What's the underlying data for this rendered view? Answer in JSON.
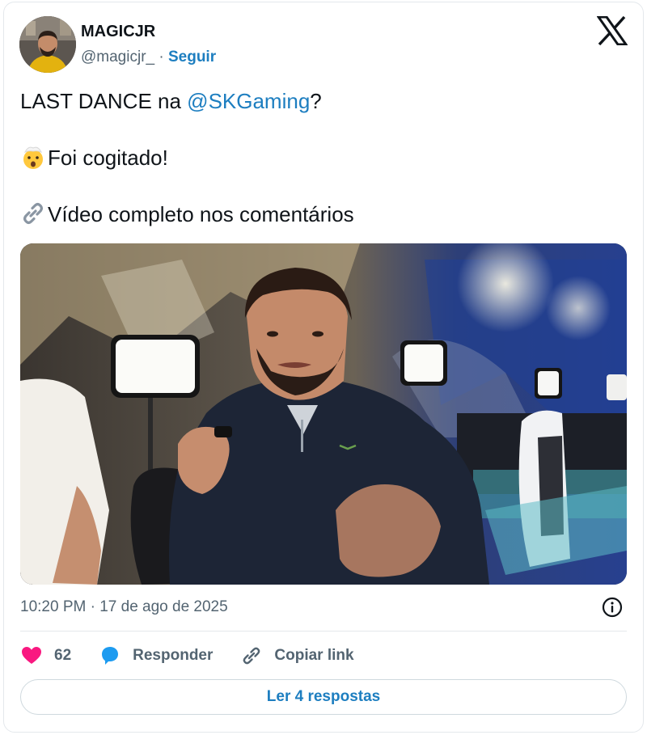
{
  "author": {
    "display_name": "MAGICJR",
    "handle": "@magicjr_",
    "separator": " · ",
    "follow_label": "Seguir"
  },
  "tweet": {
    "line1_prefix": "LAST DANCE na ",
    "line1_mention": "@SKGaming",
    "line1_suffix": "?",
    "line2_text": "Foi cogitado!",
    "line2_emoji": "exploding-head-icon",
    "line3_text": "Vídeo completo nos comentários",
    "line3_emoji": "link-icon"
  },
  "meta": {
    "timestamp": "10:20 PM · 17 de ago de 2025"
  },
  "actions": {
    "like_count": "62",
    "reply_label": "Responder",
    "copy_label": "Copiar link"
  },
  "footer": {
    "read_replies_label": "Ler 4 respostas"
  },
  "colors": {
    "link": "#1d7ec0",
    "like": "#f91880",
    "reply": "#1d9bf0",
    "muted": "#536471"
  }
}
